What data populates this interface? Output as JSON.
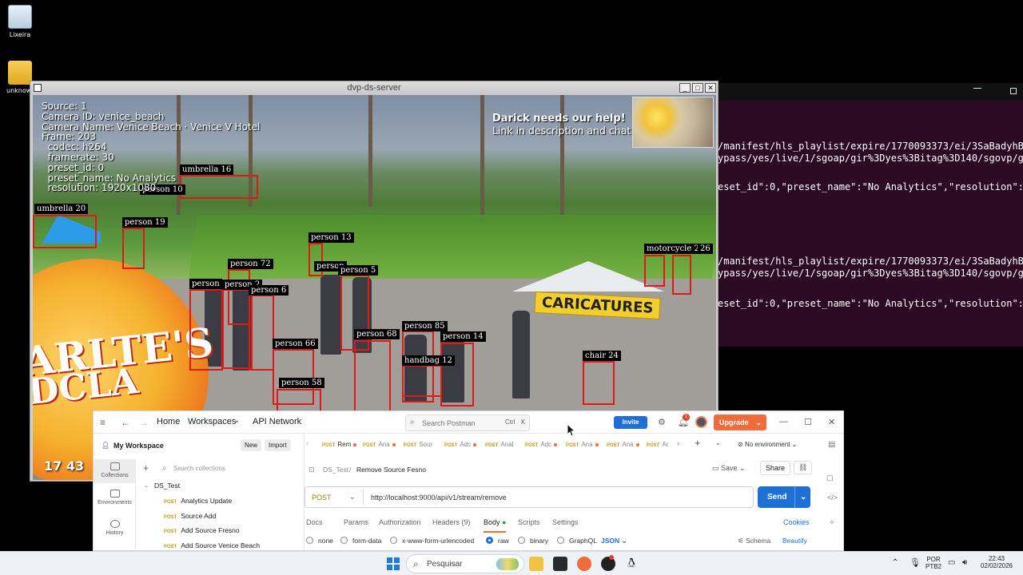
{
  "desktop": {
    "icons": [
      {
        "label": "Lixeira",
        "icon": "recycle-bin-icon"
      },
      {
        "label": "unknown",
        "icon": "folder-icon"
      }
    ]
  },
  "terminal": {
    "lines": [
      "/manifest/hls_playlist/expire/1770093373/ei/3SaBadyhBMaNob",
      "ypass/yes/live/1/sgoap/gir%3Dyes%3Bitag%3D140/sgovp/gir%3",
      "eset_id\":0,\"preset_name\":\"No Analytics\",\"resolution\":\"1920",
      "/manifest/hls_playlist/expire/1770093373/ei/3SaBadyhBMaNob",
      "ypass/yes/live/1/sgoap/gir%3Dyes%3Bitag%3D140/sgovp/gir%3",
      "eset_id\":0,\"preset_name\":\"No Analytics\",\"resolution\":\"1920"
    ]
  },
  "video_window": {
    "title": "dvp-ds-server",
    "minimize": "_",
    "maximize": "□",
    "close": "✕",
    "overlay": [
      "Source: 1",
      "Camera ID: venice_beach",
      "Camera Name: Venice Beach · Venice V Hotel",
      "Frame: 203",
      "  codec: h264",
      "  framerate: 30",
      "  preset_id: 0",
      "  preset_name: No Analytics",
      "  resolution: 1920x1080"
    ],
    "help_title": "Darick needs our help!",
    "help_sub": "Link in description and chat",
    "clock": "17 43",
    "sign_caricatures": "CARICATURES",
    "orb_line1": "ARLTE'S",
    "orb_line2": "DCLA",
    "detections": [
      "umbrella 16",
      "person 10",
      "umbrella 20",
      "person 19",
      "person 13",
      "person 72",
      "person",
      "person 5",
      "person",
      "person 2",
      "person 6",
      "motorcycle 25",
      "26",
      "person 85",
      "person 68",
      "person 14",
      "person 66",
      "handbag 12",
      "chair 24",
      "person 58"
    ]
  },
  "postman": {
    "nav": {
      "home": "Home",
      "workspaces": "Workspaces",
      "api_network": "API Network"
    },
    "search": {
      "placeholder": "Search Postman",
      "ctrl": "Ctrl",
      "k": "K"
    },
    "invite": "Invite",
    "notif_count": "1",
    "upgrade": "Upgrade",
    "workspace": "My Workspace",
    "new": "New",
    "import": "Import",
    "rail": [
      "Collections",
      "Environments",
      "History"
    ],
    "search_collections": "Search collections",
    "collection": "DS_Test",
    "items": [
      {
        "method": "POST",
        "name": "Analytics Update"
      },
      {
        "method": "POST",
        "name": "Source Add"
      },
      {
        "method": "POST",
        "name": "Add Source Fresno"
      },
      {
        "method": "POST",
        "name": "Add Source Venice Beach"
      }
    ],
    "tabs": [
      {
        "method": "POST",
        "name": "Rem",
        "dot": true
      },
      {
        "method": "POST",
        "name": "Ana",
        "dot": true
      },
      {
        "method": "POST",
        "name": "Sour",
        "dot": false
      },
      {
        "method": "POST",
        "name": "Adc",
        "dot": true
      },
      {
        "method": "POST",
        "name": "Anal",
        "dot": false
      },
      {
        "method": "POST",
        "name": "Adc",
        "dot": true
      },
      {
        "method": "POST",
        "name": "Ana",
        "dot": true
      },
      {
        "method": "POST",
        "name": "Ana",
        "dot": true
      },
      {
        "method": "POST",
        "name": "Ar",
        "dot": false
      }
    ],
    "environment": "No environment",
    "breadcrumb_parent": "DS_Test",
    "breadcrumb_sep": "/",
    "request_name": "Remove Source Fesno",
    "save": "Save",
    "share": "Share",
    "method": "POST",
    "url": "http://localhost:9000/api/v1/stream/remove",
    "send": "Send",
    "subtabs": [
      "Docs",
      "Params",
      "Authorization",
      "Headers (9)",
      "Body",
      "Scripts",
      "Settings"
    ],
    "cookies": "Cookies",
    "body_types": [
      "none",
      "form-data",
      "x-www-form-urlencoded",
      "raw",
      "binary",
      "GraphQL"
    ],
    "body_format": "JSON",
    "schema": "Schema",
    "beautify": "Beautify"
  },
  "taskbar": {
    "search": "Pesquisar",
    "lang_1": "POR",
    "lang_2": "PTB2",
    "time": "22:43",
    "date": "02/02/2026"
  },
  "colors": {
    "accent_blue": "#1f70d6",
    "upgrade_orange": "#f26b3a",
    "detection_red": "#e01818"
  }
}
